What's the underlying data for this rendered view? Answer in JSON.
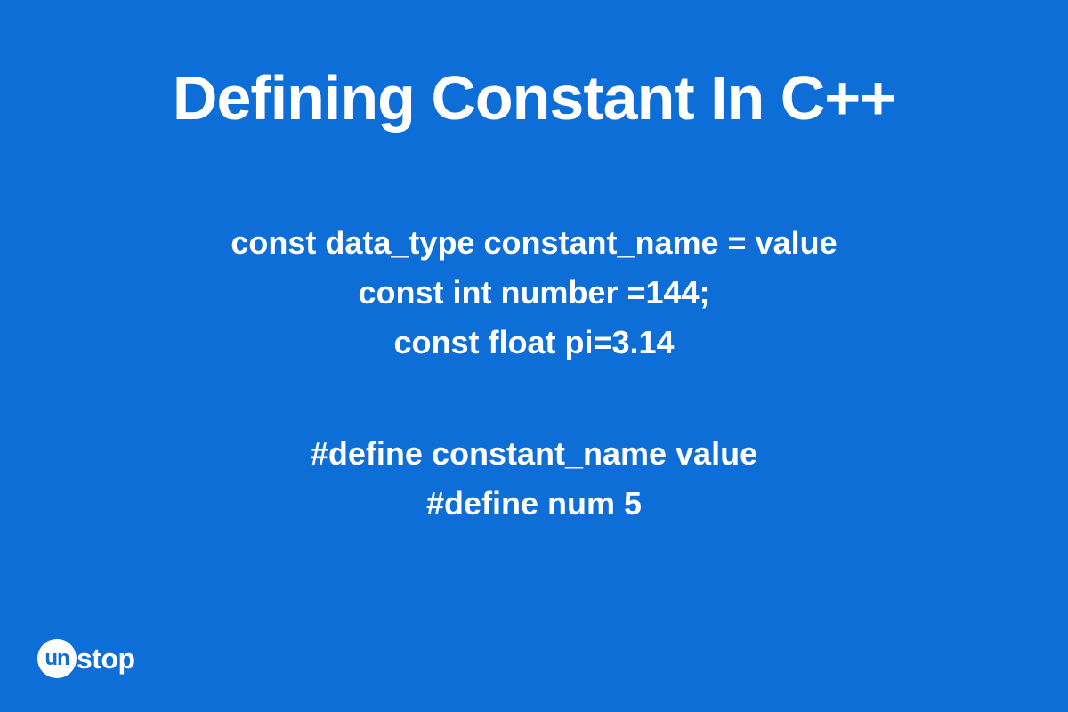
{
  "title": "Defining Constant In C++",
  "block1": {
    "line1": "const data_type constant_name = value",
    "line2": "const int number =144;",
    "line3": "const float pi=3.14"
  },
  "block2": {
    "line1": "#define constant_name value",
    "line2": "#define num 5"
  },
  "logo": {
    "circle_text": "un",
    "text": "stop"
  }
}
